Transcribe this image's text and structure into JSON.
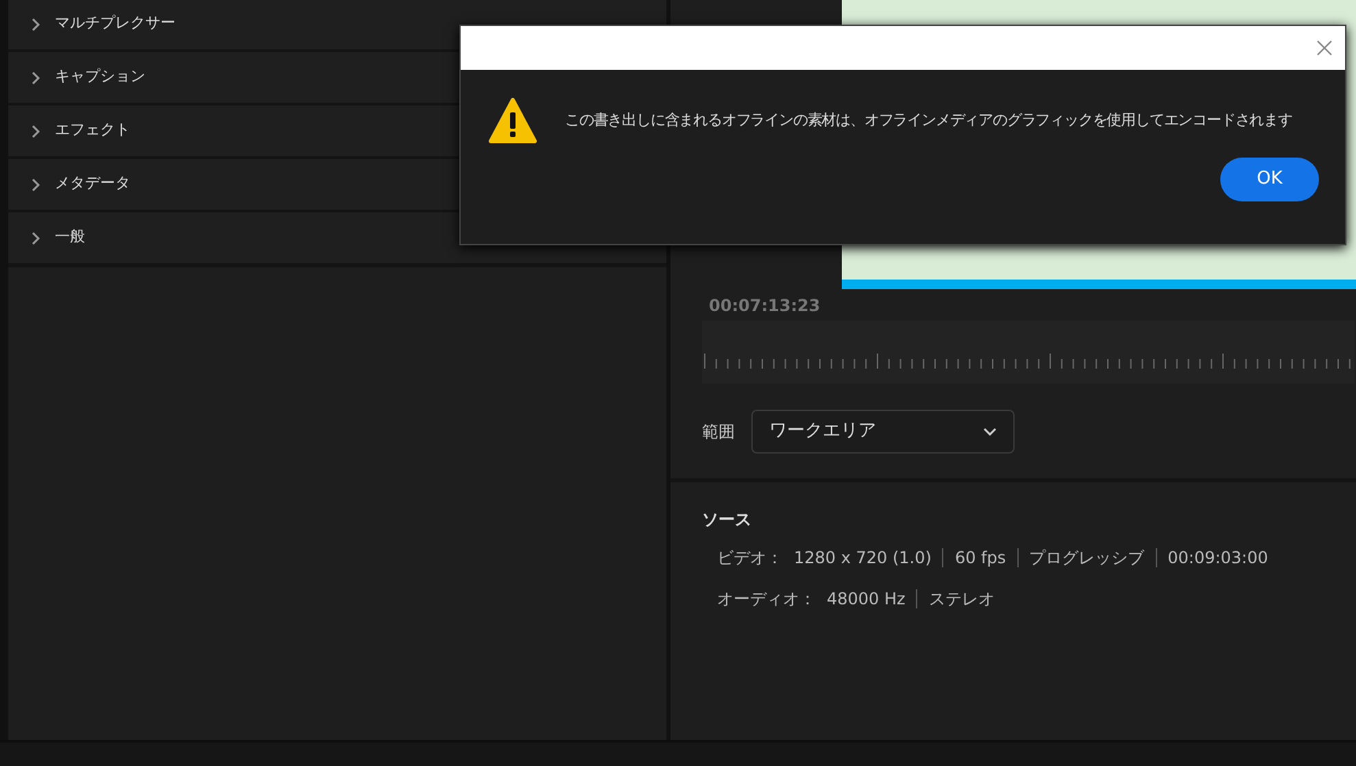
{
  "sections": [
    {
      "label": "マルチプレクサー",
      "expanded": false
    },
    {
      "label": "キャプション",
      "expanded": false
    },
    {
      "label": "エフェクト",
      "expanded": false
    },
    {
      "label": "メタデータ",
      "expanded": false
    },
    {
      "label": "一般",
      "expanded": false
    }
  ],
  "timecode": "00:07:13:23",
  "range": {
    "label": "範囲",
    "value": "ワークエリア"
  },
  "source": {
    "title": "ソース",
    "rows": [
      {
        "label": "ビデオ：",
        "values": [
          "1280 x 720 (1.0)",
          "60 fps",
          "プログレッシブ",
          "00:09:03:00"
        ]
      },
      {
        "label": "オーディオ：",
        "values": [
          "48000 Hz",
          "ステレオ"
        ]
      }
    ]
  },
  "dialog": {
    "message": "この書き出しに含まれるオフラインの素材は、オフラインメディアのグラフィックを使用してエンコードされます",
    "button": "OK"
  }
}
